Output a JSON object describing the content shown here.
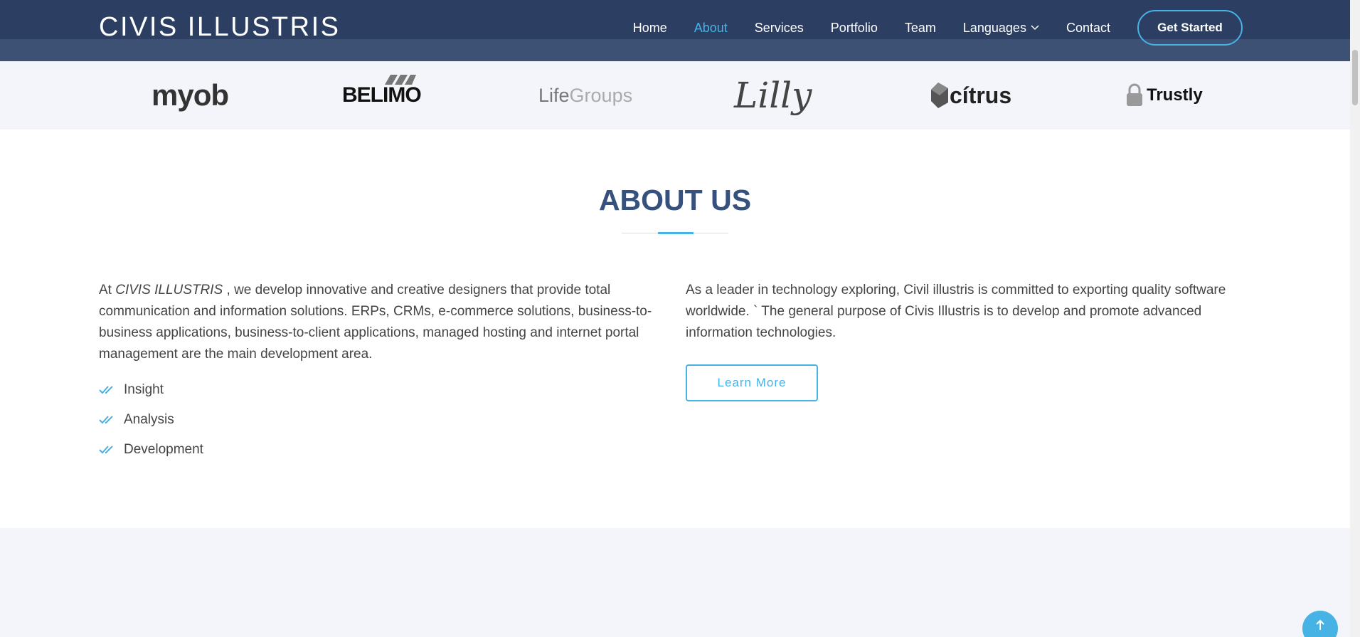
{
  "header": {
    "logo": "CIVIS ILLUSTRIS",
    "nav": [
      {
        "label": "Home",
        "active": false
      },
      {
        "label": "About",
        "active": true
      },
      {
        "label": "Services",
        "active": false
      },
      {
        "label": "Portfolio",
        "active": false
      },
      {
        "label": "Team",
        "active": false
      },
      {
        "label": "Languages",
        "active": false,
        "dropdown": true
      },
      {
        "label": "Contact",
        "active": false
      }
    ],
    "cta_label": "Get Started"
  },
  "clients": [
    {
      "name": "myob",
      "label": "myob"
    },
    {
      "name": "belimo",
      "label": "BELIMO"
    },
    {
      "name": "lifegroups",
      "label_a": "Life",
      "label_b": "Groups"
    },
    {
      "name": "lilly",
      "label": "Lilly"
    },
    {
      "name": "citrus",
      "label": "cítrus"
    },
    {
      "name": "trustly",
      "label": "Trustly"
    }
  ],
  "about": {
    "title": "ABOUT US",
    "left_intro_prefix": "At ",
    "left_intro_brand": "CIVIS ILLUSTRIS",
    "left_intro_rest": " , we develop innovative and creative designers that provide total communication and information solutions. ERPs, CRMs, e-commerce solutions, business-to-business applications, business-to-client applications, managed hosting and internet portal management are the main development area.",
    "list": [
      "Insight",
      "Analysis",
      "Development"
    ],
    "right_text": "As a leader in technology exploring, Civil illustris is committed to exporting quality software worldwide. ` The general purpose of Civis Illustris is to develop and promote advanced information technologies.",
    "learn_more_label": "Learn More"
  },
  "colors": {
    "header_bg": "#2c3f62",
    "accent": "#47b2e4",
    "title": "#37517e",
    "text": "#444444"
  }
}
